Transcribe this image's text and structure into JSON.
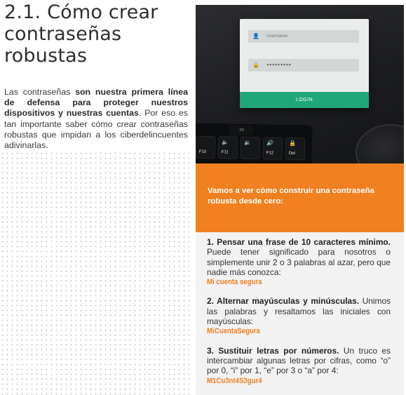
{
  "title": "2.1. Cómo crear contraseñas robustas",
  "intro": {
    "part1": "Las contraseñas ",
    "bold1": "son nuestra primera línea de defensa para proteger nuestros dispositivos y nuestras cuentas",
    "part2": ". Por eso es tan importante saber cómo crear contraseñas robustas que impidan a los ciberdelincuentes adivinarlas."
  },
  "photo": {
    "username_placeholder": "Username",
    "password_placeholder": "●●●●●●●●●",
    "login_label": "LOGIN",
    "keys": [
      "F10",
      "F11",
      "F12",
      "Del"
    ]
  },
  "callout": "Vamos a ver cómo construir una contraseña robusta desde cero:",
  "steps": [
    {
      "heading": "1. Pensar una frase de 10 caracteres mínimo.",
      "text": " Puede tener significado para nosotros o simplemente unir 2 o 3 palabras al azar, pero que nadie más conozca:",
      "example": "Mi cuenta segura"
    },
    {
      "heading": "2. Alternar mayúsculas y minúsculas.",
      "text": " Unimos las palabras y resaltamos las iniciales con mayúsculas:",
      "example": "MiCuentaSegura"
    },
    {
      "heading": "3. Sustituir letras por números.",
      "text": " Un truco es intercambiar algunas letras por cifras, como “o” por 0, “i” por 1, “e” por 3 o “a” por 4:",
      "example": "M1Cu3nt4S3gur4"
    }
  ],
  "colors": {
    "accent": "#f08020",
    "login_green": "#1fa77a"
  }
}
